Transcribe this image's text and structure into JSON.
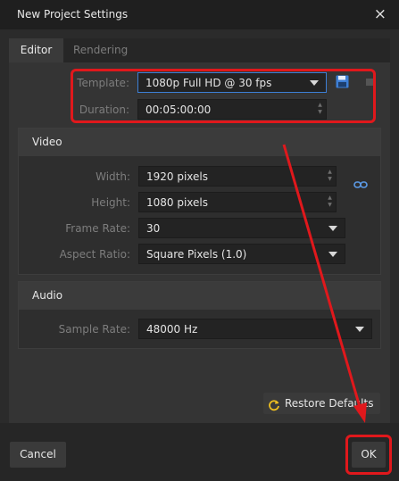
{
  "window": {
    "title": "New Project Settings",
    "close_icon": "×"
  },
  "tabs": [
    {
      "label": "Editor"
    },
    {
      "label": "Rendering"
    }
  ],
  "template": {
    "label": "Template:",
    "value": "1080p Full HD @ 30 fps"
  },
  "duration": {
    "label": "Duration:",
    "value": "00:05:00:00"
  },
  "video": {
    "heading": "Video",
    "width": {
      "label": "Width:",
      "value": "1920 pixels"
    },
    "height": {
      "label": "Height:",
      "value": "1080 pixels"
    },
    "frame_rate": {
      "label": "Frame Rate:",
      "value": "30"
    },
    "aspect_ratio": {
      "label": "Aspect Ratio:",
      "value": "Square Pixels (1.0)"
    }
  },
  "audio": {
    "heading": "Audio",
    "sample_rate": {
      "label": "Sample Rate:",
      "value": "48000 Hz"
    }
  },
  "buttons": {
    "restore": "Restore Defaults",
    "cancel": "Cancel",
    "ok": "OK"
  },
  "colors": {
    "annotation": "#e0181c",
    "accent": "#3d7fd6",
    "restore_icon": "#f0c020"
  }
}
